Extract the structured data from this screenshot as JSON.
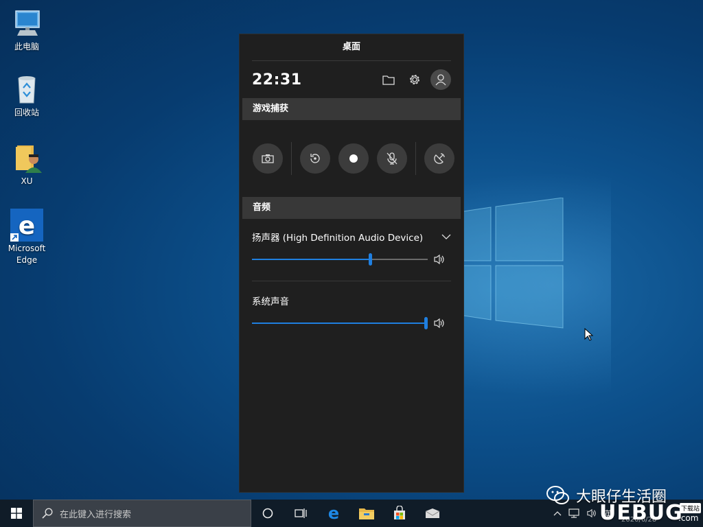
{
  "desktop": {
    "icons": [
      {
        "label": "此电脑"
      },
      {
        "label": "回收站"
      },
      {
        "label": "XU"
      },
      {
        "label": "Microsoft Edge"
      }
    ]
  },
  "gamebar": {
    "title": "桌面",
    "time": "22:31",
    "capture_section": "游戏捕获",
    "audio_section": "音频",
    "speaker_label": "扬声器 (High Definition Audio Device)",
    "speaker_volume_percent": 67,
    "system_sound_label": "系统声音",
    "system_volume_percent": 100
  },
  "taskbar": {
    "search_placeholder": "在此键入进行搜索",
    "ime": "英"
  },
  "watermark": {
    "name": "大眼仔生活圈",
    "brand": "UEBUG",
    "tag": "下载站",
    "com": ".com",
    "date": "2020/6/28"
  },
  "colors": {
    "accent": "#1f7fe0",
    "panel_bg": "#1f1f1f",
    "section_bg": "#383838"
  }
}
